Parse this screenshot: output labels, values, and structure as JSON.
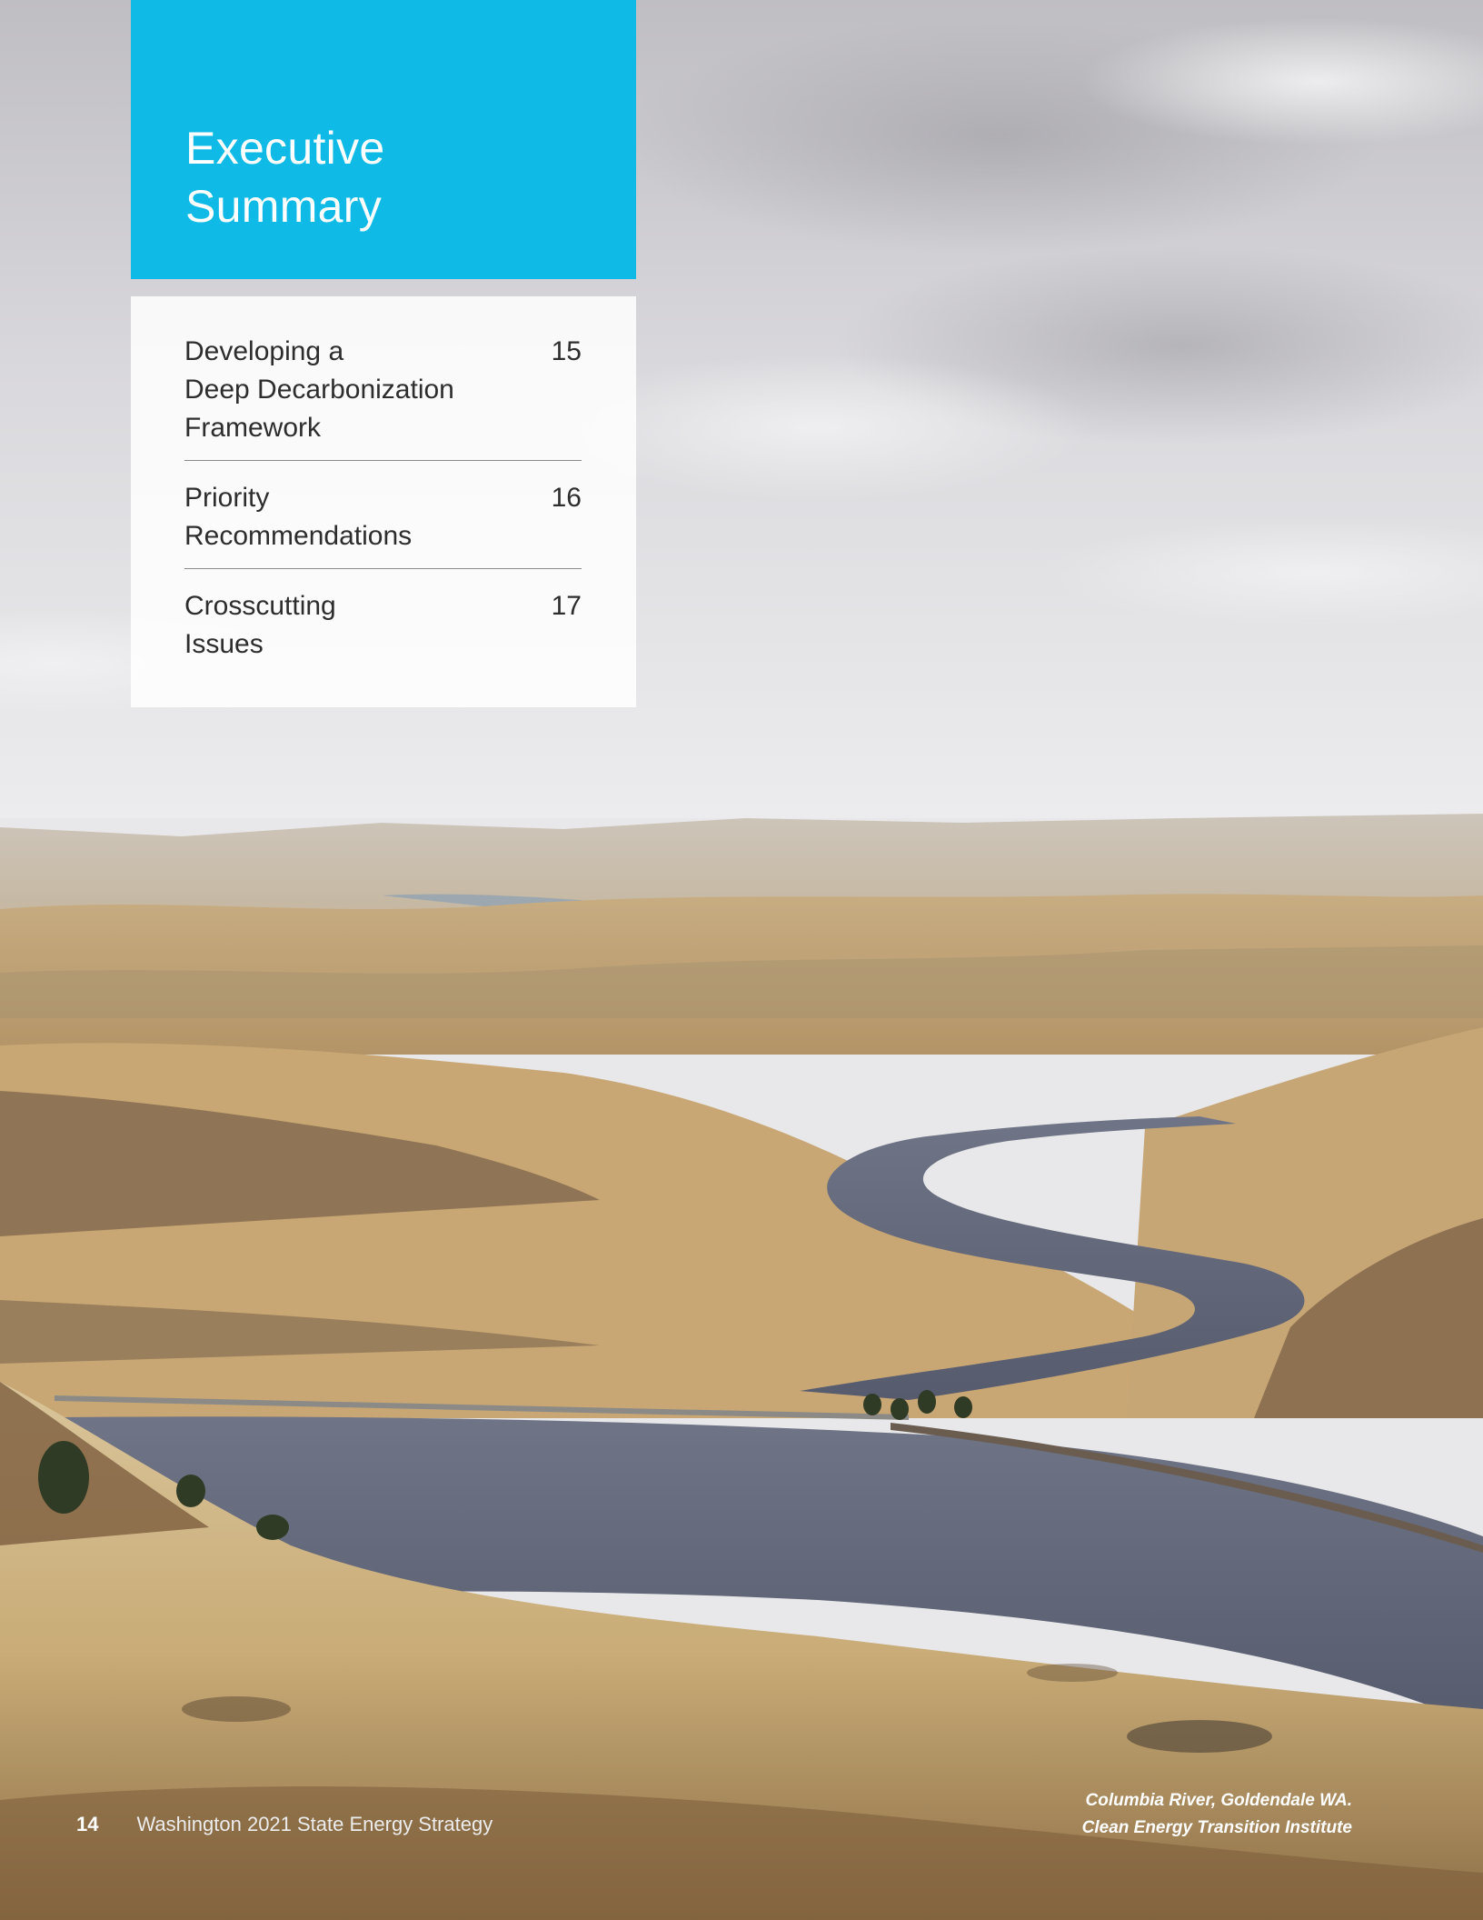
{
  "header": {
    "title_line1": "Executive",
    "title_line2": "Summary"
  },
  "toc": {
    "entries": [
      {
        "label_lines": [
          "Developing a",
          "Deep Decarbonization",
          "Framework"
        ],
        "page": "15"
      },
      {
        "label_lines": [
          "Priority",
          "Recommendations"
        ],
        "page": "16"
      },
      {
        "label_lines": [
          "Crosscutting",
          "Issues"
        ],
        "page": "17"
      }
    ]
  },
  "footer": {
    "page_number": "14",
    "document_title": "Washington 2021 State Energy Strategy"
  },
  "photo": {
    "caption_line1": "Columbia River, Goldendale WA.",
    "caption_line2": "Clean Energy Transition Institute"
  },
  "colors": {
    "accent": "#0fbbe6",
    "panel": "#ffffff",
    "text": "#2d2d2d"
  }
}
